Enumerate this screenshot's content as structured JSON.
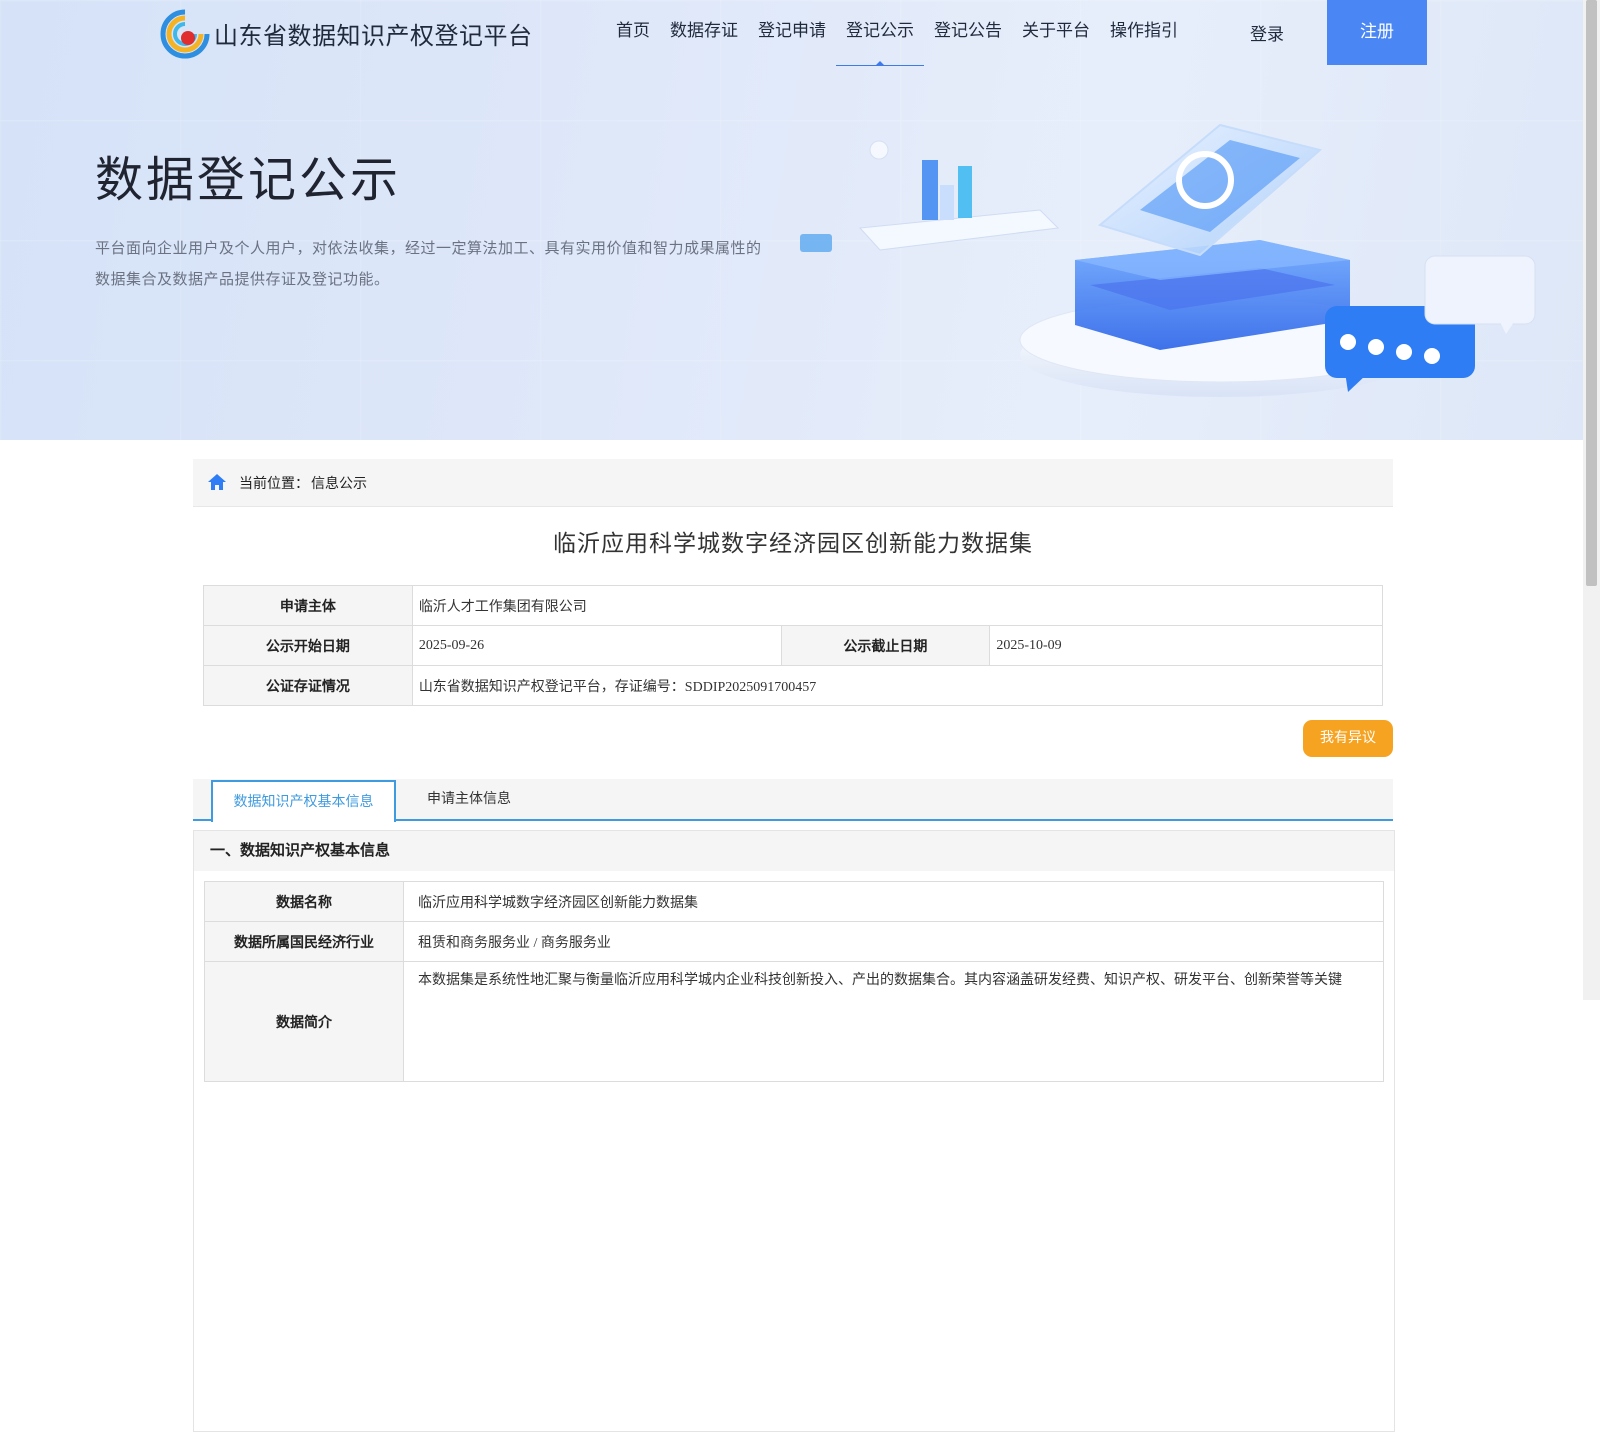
{
  "site": {
    "name": "山东省数据知识产权登记平台"
  },
  "nav": {
    "items": [
      "首页",
      "数据存证",
      "登记申请",
      "登记公示",
      "登记公告",
      "关于平台",
      "操作指引"
    ],
    "login": "登录",
    "register": "注册"
  },
  "hero": {
    "title": "数据登记公示",
    "desc_line1": "平台面向企业用户及个人用户，对依法收集，经过一定算法加工、具有实用价值和智力成果属性的",
    "desc_line2": "数据集合及数据产品提供存证及登记功能。"
  },
  "breadcrumb": {
    "prefix": "当前位置：",
    "current": "信息公示"
  },
  "record": {
    "title": "临沂应用科学城数字经济园区创新能力数据集",
    "applicant_label": "申请主体",
    "applicant": "临沂人才工作集团有限公司",
    "start_label": "公示开始日期",
    "start": "2025-09-26",
    "end_label": "公示截止日期",
    "end": "2025-10-09",
    "notary_label": "公证存证情况",
    "notary": "山东省数据知识产权登记平台，存证编号：SDDIP2025091700457",
    "objection": "我有异议"
  },
  "tabs": [
    "数据知识产权基本信息",
    "申请主体信息"
  ],
  "section": {
    "heading": "一、数据知识产权基本信息",
    "name_label": "数据名称",
    "name": "临沂应用科学城数字经济园区创新能力数据集",
    "industry_label": "数据所属国民经济行业",
    "industry": "租赁和商务服务业 / 商务服务业",
    "intro_label": "数据简介",
    "intro": "本数据集是系统性地汇聚与衡量临沂应用科学城内企业科技创新投入、产出的数据集合。其内容涵盖研发经费、知识产权、研发平台、创新荣誉等关键"
  }
}
